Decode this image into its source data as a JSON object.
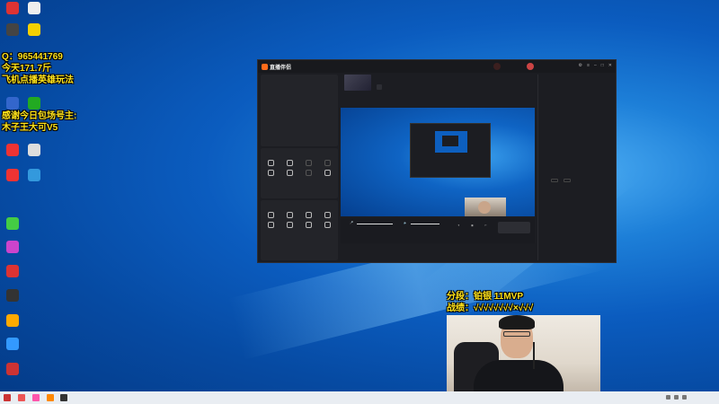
{
  "overlay": {
    "qq": "Q：965441769",
    "today": "今天171.7斤",
    "topic": "飞机点播英雄玩法",
    "thanks": "感谢今日包场号主:",
    "sponsor": "木子王大可V5",
    "rank": "分段：铂银   11MVP",
    "record": "战绩：√√√√√√√√×√√√"
  },
  "desktop_icons": [
    {
      "label": "",
      "color": "#d33"
    },
    {
      "label": "",
      "color": "#eee"
    },
    {
      "label": "",
      "color": "#444"
    },
    {
      "label": "",
      "color": "#f5d000"
    },
    {
      "label": "",
      "color": "#36c"
    },
    {
      "label": "",
      "color": "#2a2"
    },
    {
      "label": "",
      "color": "#e33"
    },
    {
      "label": "",
      "color": "#ddd"
    },
    {
      "label": "",
      "color": "#e33"
    },
    {
      "label": "",
      "color": "#39d"
    },
    {
      "label": "",
      "color": "#4c4"
    },
    {
      "label": "",
      "color": "#c4c"
    },
    {
      "label": "",
      "color": "#d33"
    },
    {
      "label": "",
      "color": "#333"
    },
    {
      "label": "",
      "color": "#fa0"
    },
    {
      "label": "",
      "color": "#39f"
    },
    {
      "label": "",
      "color": "#c33"
    }
  ],
  "app": {
    "name": "直播伴侣",
    "live_pill": "",
    "left": {
      "mode": "",
      "scenes": [
        "",
        "",
        "",
        ""
      ],
      "add_scene": "",
      "section_tools": "",
      "tools_row1": [
        "",
        "",
        "",
        ""
      ],
      "tools_row2": [
        "",
        "",
        "",
        ""
      ],
      "section_interact": "",
      "tools_row3": [
        "",
        "",
        "",
        ""
      ],
      "tools_row4": [
        "",
        "",
        "",
        ""
      ],
      "more": ""
    },
    "center": {
      "room_title": "",
      "room_tag": "",
      "start_button": "",
      "mic_label": "",
      "speaker_label": ""
    },
    "right": {
      "tabs": [
        "",
        ""
      ],
      "empty_msg": "",
      "buttons": [
        "",
        ""
      ]
    }
  },
  "taskbar": {
    "time": "",
    "date": ""
  }
}
